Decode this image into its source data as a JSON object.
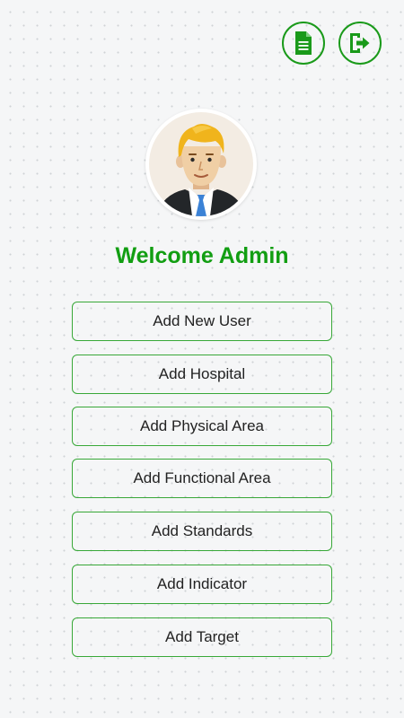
{
  "header": {
    "report_icon": "document-icon",
    "logout_icon": "logout-icon"
  },
  "profile": {
    "avatar": "user-avatar",
    "welcome_text": "Welcome Admin"
  },
  "menu": {
    "items": [
      {
        "label": "Add New User"
      },
      {
        "label": "Add Hospital"
      },
      {
        "label": "Add Physical Area"
      },
      {
        "label": "Add Functional Area"
      },
      {
        "label": "Add Standards"
      },
      {
        "label": "Add Indicator"
      },
      {
        "label": "Add Target"
      }
    ]
  },
  "colors": {
    "accent": "#129e12",
    "button_border": "#38a838",
    "background": "#f5f6f7"
  }
}
